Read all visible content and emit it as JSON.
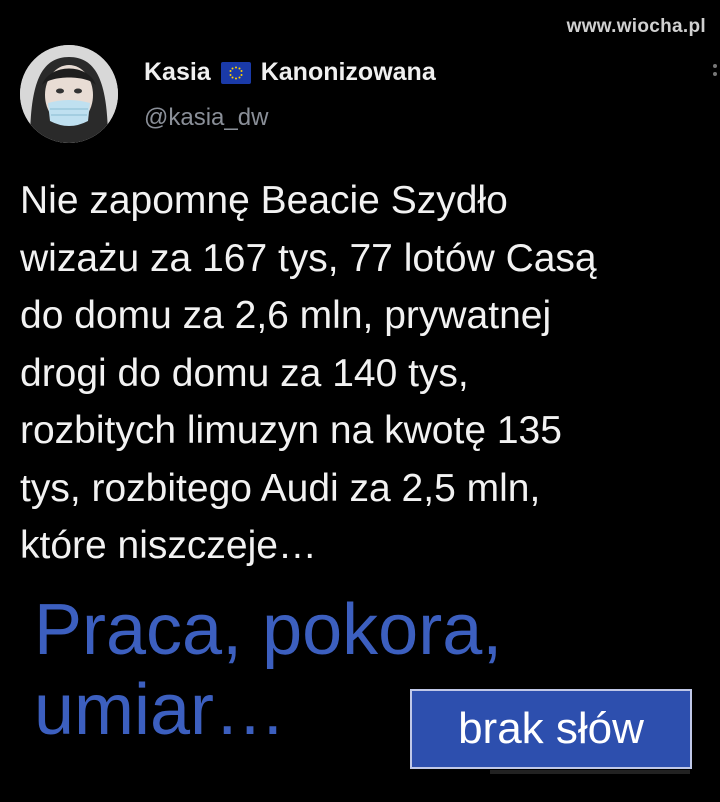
{
  "watermark": "www.wiocha.pl",
  "tweet": {
    "display_name_first": "Kasia",
    "display_name_last": "Kanonizowana",
    "flag_icon": "eu-flag-icon",
    "handle": "@kasia_dw",
    "text": "Nie zapomnę Beacie Szydło\nwizażu za 167 tys, 77 lotów Casą\ndo domu za 2,6 mln, prywatnej\ndrogi do domu za 140 tys,\nrozbitych limuzyn na kwotę 135\ntys, rozbitego Audi za 2,5 mln,\nktóre niszczeje…"
  },
  "caption": {
    "text": "Praca, pokora,\numiar…",
    "color": "#3c5fbf"
  },
  "tag": {
    "label": "brak słów",
    "color": "#2d4fae"
  }
}
